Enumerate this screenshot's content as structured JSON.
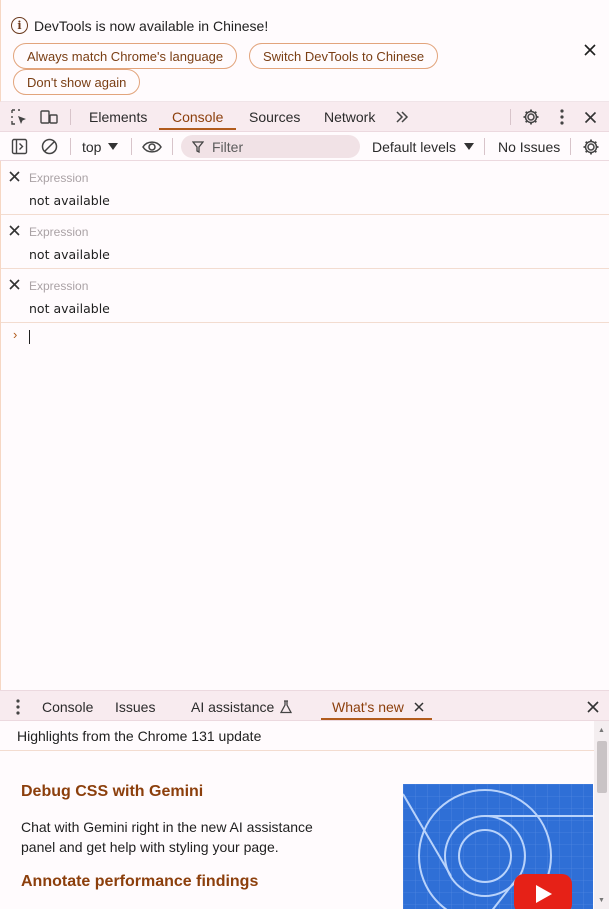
{
  "infobar": {
    "message": "DevTools is now available in Chinese!",
    "buttons": {
      "match_language": "Always match Chrome's language",
      "switch_chinese": "Switch DevTools to Chinese",
      "dont_show": "Don't show again"
    },
    "close_icon": "close-icon"
  },
  "main_toolbar": {
    "tabs": [
      "Elements",
      "Console",
      "Sources",
      "Network"
    ],
    "active_tab": "Console",
    "more_tabs_icon": "double-chevron-right-icon",
    "icons": [
      "inspect-element-icon",
      "device-toolbar-icon",
      "settings-gear-icon",
      "more-vertical-icon",
      "close-icon"
    ]
  },
  "console_toolbar": {
    "context": "top",
    "filter_placeholder": "Filter",
    "levels": "Default levels",
    "issues": "No Issues",
    "icons": [
      "sidebar-toggle-icon",
      "clear-console-icon",
      "eye-icon",
      "filter-icon",
      "settings-gear-icon"
    ]
  },
  "live_expressions": [
    {
      "label": "Expression",
      "value": "not available"
    },
    {
      "label": "Expression",
      "value": "not available"
    },
    {
      "label": "Expression",
      "value": "not available"
    }
  ],
  "prompt_symbol": "›",
  "drawer": {
    "tabs": [
      "Console",
      "Issues",
      "AI assistance",
      "What's new"
    ],
    "active_tab": "What's new",
    "whats_new": {
      "header": "Highlights from the Chrome 131 update",
      "items": [
        {
          "title": "Debug CSS with Gemini",
          "body": "Chat with Gemini right in the new AI assistance panel and get help with styling your page."
        },
        {
          "title": "Annotate performance findings"
        }
      ]
    }
  },
  "colors": {
    "accent": "#8c3f0c",
    "underline": "#b15b1c",
    "toolbar_bg": "#f8ebef",
    "page_bg": "#fffbfd",
    "pill_border": "#e2a47c",
    "promo_blue": "#2f6fd6",
    "youtube_red": "#e62117"
  }
}
